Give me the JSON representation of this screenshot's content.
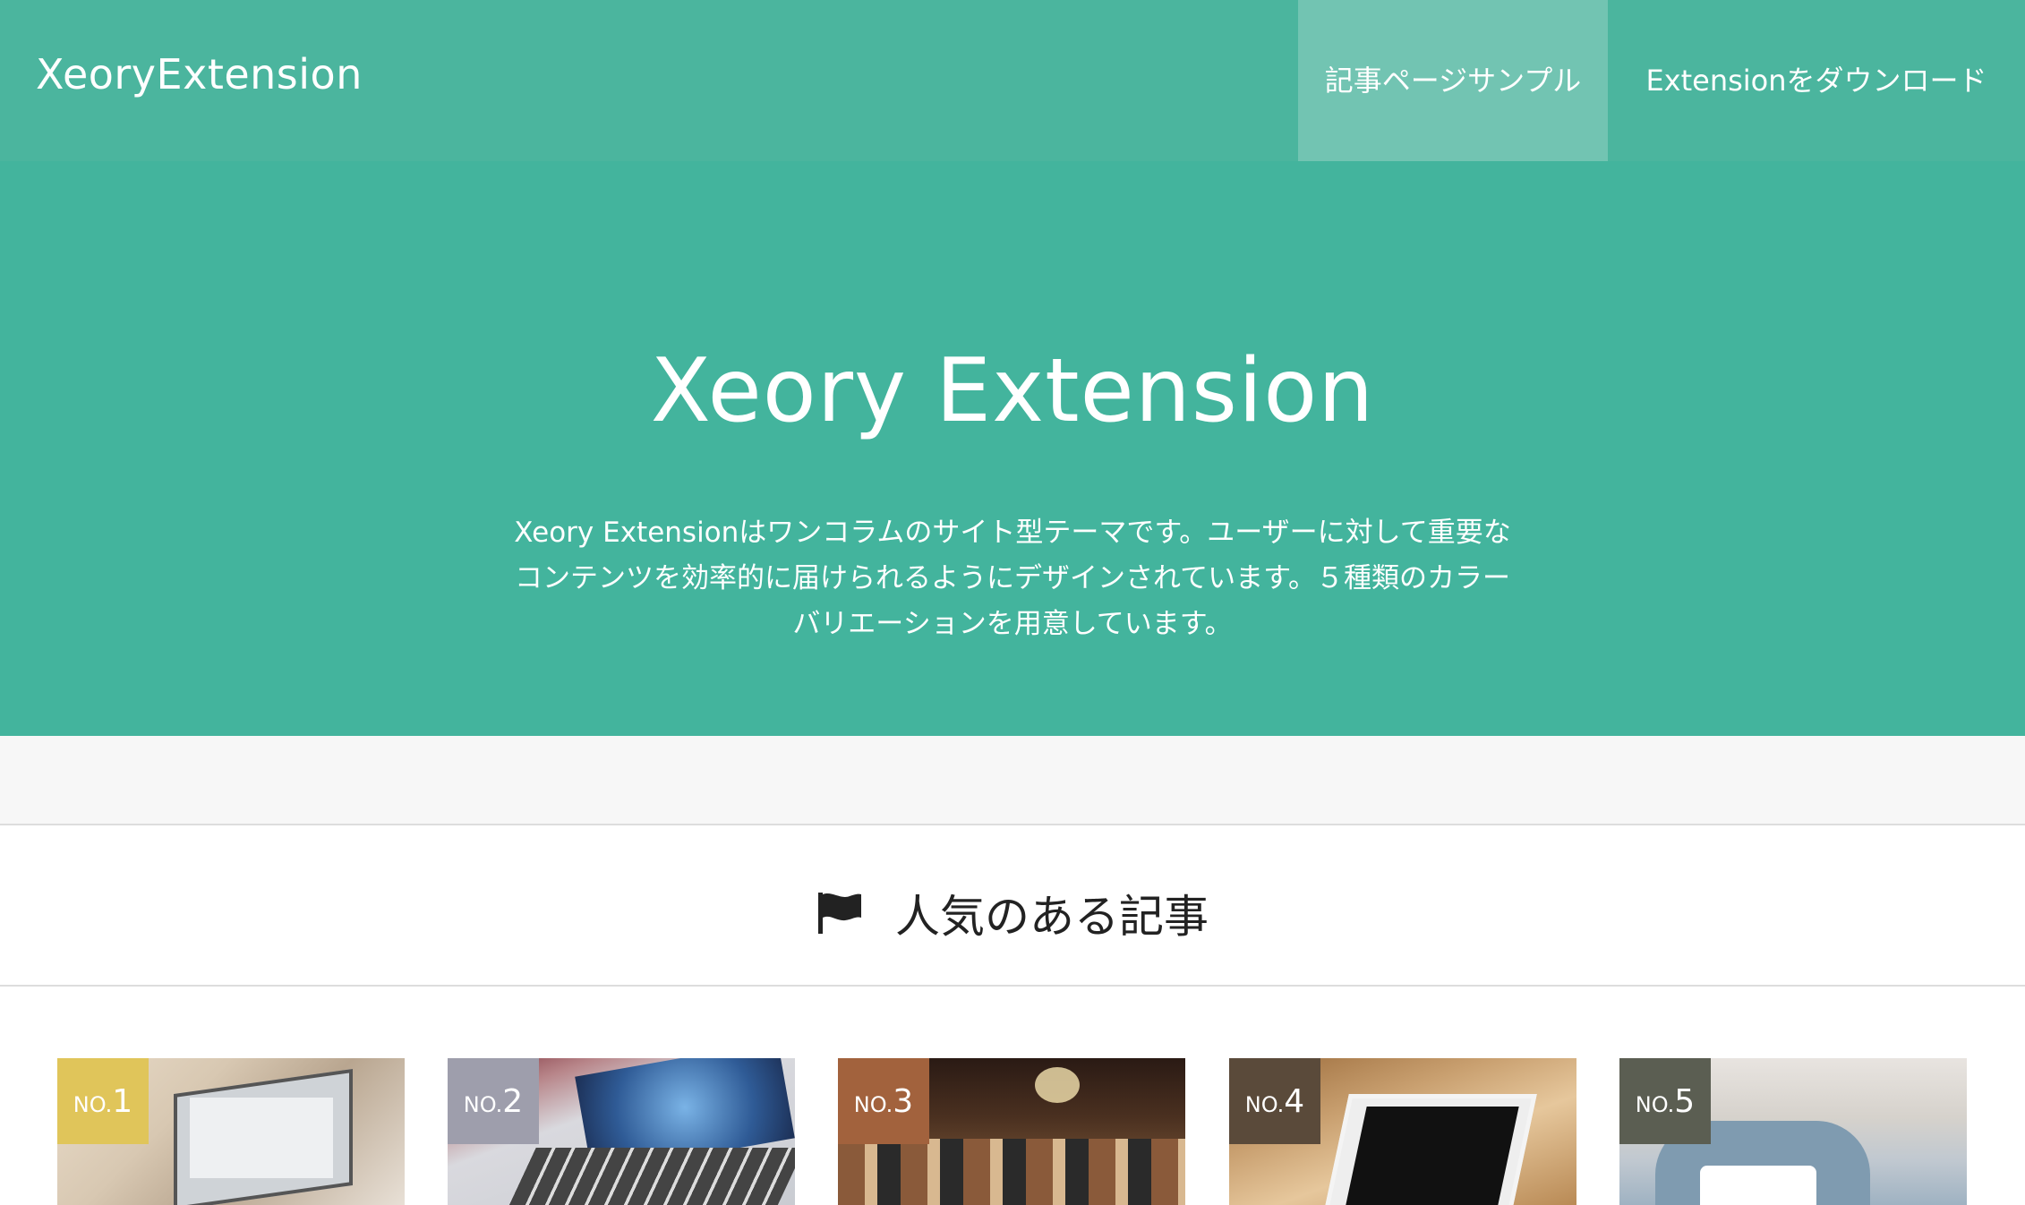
{
  "navbar": {
    "brand": "XeoryExtension",
    "items": [
      {
        "label": "記事ページサンプル"
      },
      {
        "label": "Extensionをダウンロード"
      }
    ]
  },
  "hero": {
    "title": "Xeory Extension",
    "description": "Xeory Extensionはワンコラムのサイト型テーマです。ユーザーに対して重要なコンテンツを効率的に届けられるようにデザインされています。５種類のカラーバリエーションを用意しています。"
  },
  "popular": {
    "heading": "人気のある記事",
    "cards": [
      {
        "rank_prefix": "NO.",
        "rank_num": "1",
        "badge_color": "#e0c55a"
      },
      {
        "rank_prefix": "NO.",
        "rank_num": "2",
        "badge_color": "#9e9eac"
      },
      {
        "rank_prefix": "NO.",
        "rank_num": "3",
        "badge_color": "#a2623d"
      },
      {
        "rank_prefix": "NO.",
        "rank_num": "4",
        "badge_color": "#5a4a3a"
      },
      {
        "rank_prefix": "NO.",
        "rank_num": "5",
        "badge_color": "#5b5e52"
      }
    ]
  },
  "colors": {
    "navbar": "#4bb59e",
    "nav_active": "#72c4b2",
    "hero": "#43b49d"
  }
}
